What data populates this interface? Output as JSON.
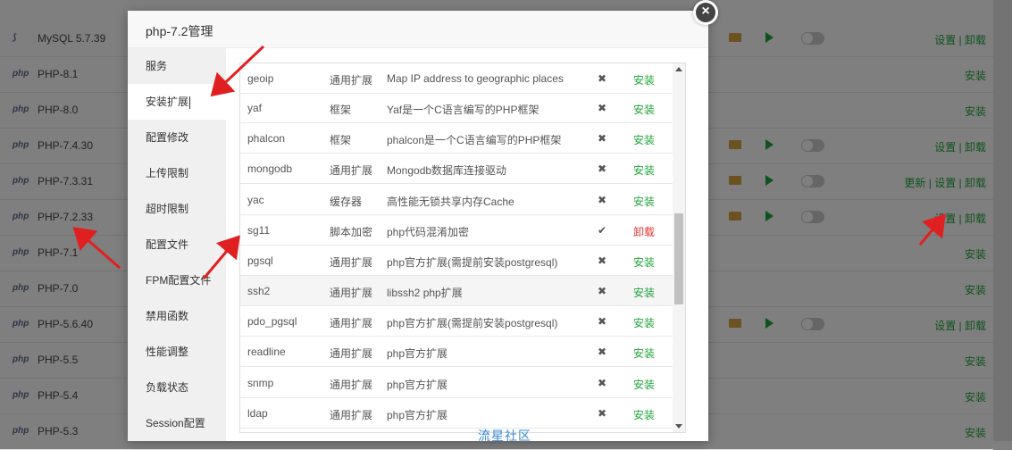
{
  "background": {
    "rows": [
      {
        "icon": "mysql-icon",
        "name": "MySQL 5.7.39",
        "actions": "设置 | 卸载",
        "controls": true
      },
      {
        "icon": "php-icon",
        "name": "PHP-8.1",
        "actions": "安装",
        "controls": false
      },
      {
        "icon": "php-icon",
        "name": "PHP-8.0",
        "actions": "安装",
        "controls": false
      },
      {
        "icon": "php-icon",
        "name": "PHP-7.4.30",
        "actions": "设置 | 卸载",
        "controls": true
      },
      {
        "icon": "php-icon",
        "name": "PHP-7.3.31",
        "actions": "更新 | 设置 | 卸载",
        "controls": true
      },
      {
        "icon": "php-icon",
        "name": "PHP-7.2.33",
        "actions": "设置 | 卸载",
        "controls": true
      },
      {
        "icon": "php-icon",
        "name": "PHP-7.1",
        "actions": "安装",
        "controls": false
      },
      {
        "icon": "php-icon",
        "name": "PHP-7.0",
        "actions": "安装",
        "controls": false
      },
      {
        "icon": "php-icon",
        "name": "PHP-5.6.40",
        "actions": "设置 | 卸载",
        "controls": true
      },
      {
        "icon": "php-icon",
        "name": "PHP-5.5",
        "actions": "安装",
        "controls": false
      },
      {
        "icon": "php-icon",
        "name": "PHP-5.4",
        "actions": "安装",
        "controls": false
      },
      {
        "icon": "php-icon",
        "name": "PHP-5.3",
        "actions": "安装",
        "controls": false
      }
    ],
    "php_label": "php"
  },
  "modal": {
    "title": "php-7.2管理",
    "close_label": "×",
    "sidebar": [
      {
        "label": "服务"
      },
      {
        "label": "安装扩展",
        "active": true
      },
      {
        "label": "配置修改"
      },
      {
        "label": "上传限制"
      },
      {
        "label": "超时限制"
      },
      {
        "label": "配置文件"
      },
      {
        "label": "FPM配置文件"
      },
      {
        "label": "禁用函数"
      },
      {
        "label": "性能调整"
      },
      {
        "label": "负载状态"
      },
      {
        "label": "Session配置"
      }
    ],
    "extensions": [
      {
        "name": "geoip",
        "type": "通用扩展",
        "desc": "Map IP address to geographic places",
        "status": "✖",
        "action": "安装"
      },
      {
        "name": "yaf",
        "type": "框架",
        "desc": "Yaf是一个C语言编写的PHP框架",
        "status": "✖",
        "action": "安装"
      },
      {
        "name": "phalcon",
        "type": "框架",
        "desc": "phalcon是一个C语言编写的PHP框架",
        "status": "✖",
        "action": "安装"
      },
      {
        "name": "mongodb",
        "type": "通用扩展",
        "desc": "Mongodb数据库连接驱动",
        "status": "✖",
        "action": "安装"
      },
      {
        "name": "yac",
        "type": "缓存器",
        "desc": "高性能无锁共享内存Cache",
        "status": "✖",
        "action": "安装"
      },
      {
        "name": "sg11",
        "type": "脚本加密",
        "desc": "php代码混淆加密",
        "status": "✔",
        "action": "卸载",
        "installed": true
      },
      {
        "name": "pgsql",
        "type": "通用扩展",
        "desc": "php官方扩展(需提前安装postgresql)",
        "status": "✖",
        "action": "安装"
      },
      {
        "name": "ssh2",
        "type": "通用扩展",
        "desc": "libssh2 php扩展",
        "status": "✖",
        "action": "安装",
        "highlight": true
      },
      {
        "name": "pdo_pgsql",
        "type": "通用扩展",
        "desc": "php官方扩展(需提前安装postgresql)",
        "status": "✖",
        "action": "安装"
      },
      {
        "name": "readline",
        "type": "通用扩展",
        "desc": "php官方扩展",
        "status": "✖",
        "action": "安装"
      },
      {
        "name": "snmp",
        "type": "通用扩展",
        "desc": "php官方扩展",
        "status": "✖",
        "action": "安装"
      },
      {
        "name": "ldap",
        "type": "通用扩展",
        "desc": "php官方扩展",
        "status": "✖",
        "action": "安装"
      }
    ]
  },
  "watermark": "流星社区",
  "colors": {
    "accent": "#20a53a",
    "danger": "#e33333",
    "annotation": "#e02020"
  }
}
